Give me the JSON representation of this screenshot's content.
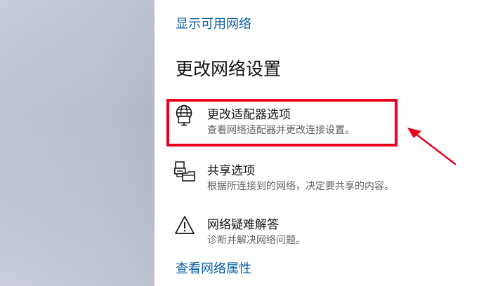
{
  "left_panel": {
    "background": "#bfc4d5"
  },
  "links": {
    "show_networks": "显示可用网络",
    "view_properties": "查看网络属性"
  },
  "section": {
    "title": "更改网络设置"
  },
  "options": [
    {
      "title": "更改适配器选项",
      "description": "查看网络适配器并更改连接设置。",
      "icon": "globe-monitor-icon"
    },
    {
      "title": "共享选项",
      "description": "根据所连接到的网络，决定要共享的内容。",
      "icon": "sharing-printer-icon"
    },
    {
      "title": "网络疑难解答",
      "description": "诊断并解决网络问题。",
      "icon": "warning-icon"
    }
  ],
  "annotation": {
    "highlight_color": "#e8001c",
    "highlighted_option": "更改适配器选项"
  },
  "colors": {
    "link": "#0a5ea8",
    "text": "#111111",
    "secondary_text": "#606060"
  }
}
